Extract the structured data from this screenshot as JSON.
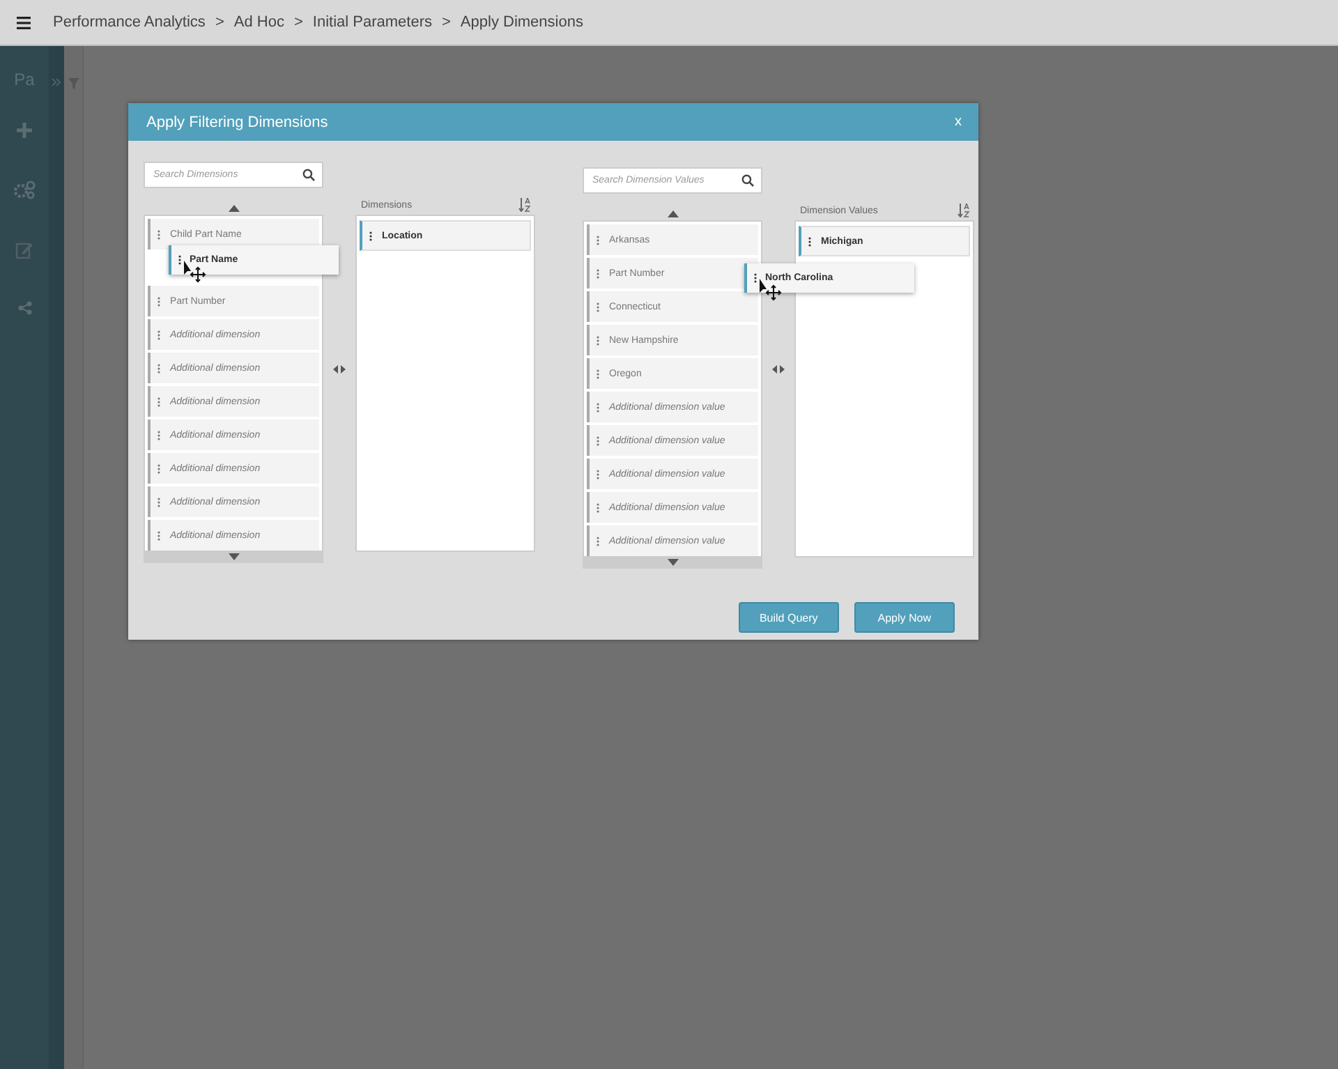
{
  "breadcrumb": {
    "separator": ">",
    "items": [
      "Performance Analytics",
      "Ad Hoc",
      "Initial Parameters",
      "Apply Dimensions"
    ]
  },
  "sidebar": {
    "title": "Pa"
  },
  "dialog": {
    "title": "Apply Filtering Dimensions",
    "close": "x",
    "panels": [
      {
        "search": {
          "placeholder": "Search Dimensions"
        },
        "selected_header": "Dimensions",
        "available": [
          {
            "label": "Child Part Name",
            "kind": "item"
          },
          {
            "kind": "slot"
          },
          {
            "label": "Part Number",
            "kind": "item"
          },
          {
            "label": "Additional dimension",
            "kind": "placeholder"
          },
          {
            "label": "Additional dimension",
            "kind": "placeholder"
          },
          {
            "label": "Additional dimension",
            "kind": "placeholder"
          },
          {
            "label": "Additional dimension",
            "kind": "placeholder"
          },
          {
            "label": "Additional dimension",
            "kind": "placeholder"
          },
          {
            "label": "Additional dimension",
            "kind": "placeholder"
          },
          {
            "label": "Additional dimension",
            "kind": "placeholder"
          }
        ],
        "selected": [
          {
            "label": "Location"
          }
        ],
        "dragging": {
          "label": "Part Name"
        }
      },
      {
        "search": {
          "placeholder": "Search Dimension Values"
        },
        "selected_header": "Dimension Values",
        "available": [
          {
            "label": "Arkansas",
            "kind": "item"
          },
          {
            "label": "Part Number",
            "kind": "item"
          },
          {
            "label": "Connecticut",
            "kind": "item"
          },
          {
            "label": "New Hampshire",
            "kind": "item"
          },
          {
            "label": "Oregon",
            "kind": "item"
          },
          {
            "label": "Additional dimension value",
            "kind": "placeholder"
          },
          {
            "label": "Additional dimension value",
            "kind": "placeholder"
          },
          {
            "label": "Additional dimension value",
            "kind": "placeholder"
          },
          {
            "label": "Additional dimension value",
            "kind": "placeholder"
          },
          {
            "label": "Additional dimension value",
            "kind": "placeholder"
          }
        ],
        "selected": [
          {
            "label": "Michigan"
          }
        ],
        "dragging": {
          "label": "North Carolina"
        }
      }
    ],
    "buttons": [
      "Build Query",
      "Apply Now"
    ]
  }
}
